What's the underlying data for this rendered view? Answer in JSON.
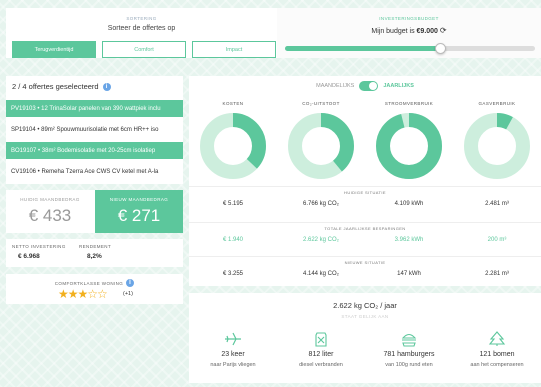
{
  "sorting": {
    "label": "SORTERING",
    "subtitle": "Sorteer de offertes op",
    "buttons": [
      "Terugverdientijd",
      "Comfort",
      "Impact"
    ]
  },
  "budget": {
    "label": "INVESTERINGSBUDGET",
    "text": "Mijn budget is",
    "amount": "€9.000",
    "level_fraction": 0.62
  },
  "offers": {
    "header": "2 / 4 offertes geselecteerd",
    "items": [
      {
        "label": "PV19103 • 12 TrinaSolar panelen van 390 wattpiek inclu",
        "selected": true
      },
      {
        "label": "SP19104 • 89m² Spouwmuurisolatie met 6cm HR++ iso",
        "selected": false
      },
      {
        "label": "BO19107 • 38m² Bodemisolatie met 20-25cm isolatiep",
        "selected": true
      },
      {
        "label": "CV19106 • Remeha Tzerra Ace CWS CV ketel met A-la",
        "selected": false
      }
    ]
  },
  "amounts": {
    "old_label": "HUIDIG MAANDBEDRAG",
    "old_value": "€ 433",
    "new_label": "NIEUW MAANDBEDRAG",
    "new_value": "€ 271"
  },
  "invest": {
    "net_label": "NETTO INVESTERING",
    "net_value": "€ 6.968",
    "return_label": "RENDEMENT",
    "return_value": "8,2%"
  },
  "comfort": {
    "label": "COMFORTKLASSE WONING",
    "stars": "★★★☆☆",
    "plus": "(+1)",
    "rating": 3
  },
  "toggle": {
    "left": "MAANDELIJKS",
    "right": "JAARLIJKS"
  },
  "donuts": [
    {
      "label": "KOSTEN",
      "fraction": 0.37
    },
    {
      "label": "CO₂-UITSTOOT",
      "fraction": 0.39
    },
    {
      "label": "STROOMVERBRUIK",
      "fraction": 0.96
    },
    {
      "label": "GASVERBRUIK",
      "fraction": 0.08
    }
  ],
  "rows": {
    "current_label": "HUIDIGE SITUATIE",
    "current": [
      "€ 5.195",
      "6.766 kg CO₂",
      "4.109 kWh",
      "2.481 m³"
    ],
    "savings_label": "TOTALE JAARLIJKSE BESPARINGEN",
    "savings": [
      "€ 1.940",
      "2.622 kg CO₂",
      "3.962 kWh",
      "200 m³"
    ],
    "new_label": "NIEUWE SITUATIE",
    "new": [
      "€ 3.255",
      "4.144 kg CO₂",
      "147 kWh",
      "2.281 m³"
    ]
  },
  "co2": {
    "title": "2.622 kg CO₂ / jaar",
    "subtitle": "STAAT GELIJK AAN",
    "items": [
      {
        "icon": "airplane-icon",
        "value": "23 keer",
        "desc": "naar Parijs vliegen"
      },
      {
        "icon": "fuel-can-icon",
        "value": "812 liter",
        "desc": "diesel verbranden"
      },
      {
        "icon": "hamburger-icon",
        "value": "781 hamburgers",
        "desc": "van 100g rund eten"
      },
      {
        "icon": "tree-icon",
        "value": "121 bomen",
        "desc": "aan het compenseren"
      }
    ]
  },
  "colors": {
    "accent": "#5cc79c",
    "accent_light": "#cdeedd",
    "info": "#6aa5e6",
    "star": "#f2b01e"
  }
}
